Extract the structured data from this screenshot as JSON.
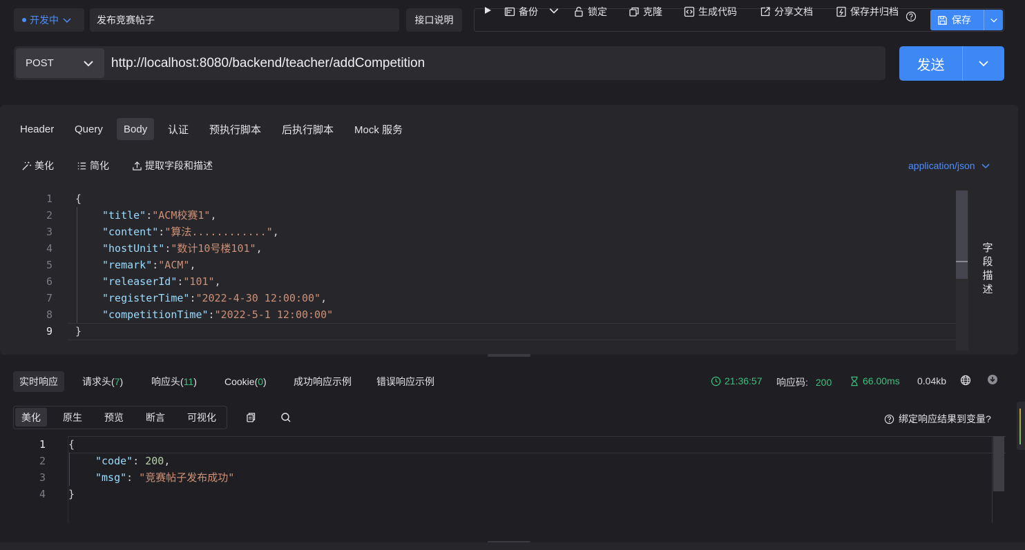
{
  "header": {
    "env_label": "开发中",
    "api_name": "发布竞赛帖子",
    "doc_button": "接口说明",
    "toolbar": {
      "run": "",
      "backup": "备份",
      "lock": "锁定",
      "clone": "克隆",
      "generate_code": "生成代码",
      "share_doc": "分享文档",
      "save_archive": "保存并归档",
      "save": "保存"
    }
  },
  "request": {
    "method": "POST",
    "url": "http://localhost:8080/backend/teacher/addCompetition",
    "send_label": "发送",
    "tabs": [
      "Header",
      "Query",
      "Body",
      "认证",
      "预执行脚本",
      "后执行脚本",
      "Mock 服务"
    ],
    "active_tab": "Body",
    "body_tools": [
      "美化",
      "简化",
      "提取字段和描述"
    ],
    "content_type": "application/json",
    "field_desc_label": "字段描述",
    "body_lines": [
      {
        "n": "1",
        "text": "{"
      },
      {
        "n": "2",
        "key": "\"title\"",
        "val": "\"ACM校赛1\"",
        "end": ","
      },
      {
        "n": "3",
        "key": "\"content\"",
        "val": "\"算法............\"",
        "end": ","
      },
      {
        "n": "4",
        "key": "\"hostUnit\"",
        "val": "\"数计10号楼101\"",
        "end": ","
      },
      {
        "n": "5",
        "key": "\"remark\"",
        "val": "\"ACM\"",
        "end": ","
      },
      {
        "n": "6",
        "key": "\"releaserId\"",
        "val": "\"101\"",
        "end": ","
      },
      {
        "n": "7",
        "key": "\"registerTime\"",
        "val": "\"2022-4-30 12:00:00\"",
        "end": ","
      },
      {
        "n": "8",
        "key": "\"competitionTime\"",
        "val": "\"2022-5-1 12:00:00\"",
        "end": ""
      },
      {
        "n": "9",
        "text": "}"
      }
    ]
  },
  "response": {
    "tabs": [
      {
        "label": "实时响应"
      },
      {
        "label": "请求头(",
        "count": "7",
        "close": ")"
      },
      {
        "label": "响应头(",
        "count": "11",
        "close": ")"
      },
      {
        "label": "Cookie(",
        "count": "0",
        "close": ")"
      },
      {
        "label": "成功响应示例"
      },
      {
        "label": "错误响应示例"
      }
    ],
    "time": "21:36:57",
    "status_label": "响应码:",
    "status_code": "200",
    "duration": "66.00ms",
    "size": "0.04kb",
    "view_tabs": [
      "美化",
      "原生",
      "预览",
      "断言",
      "可视化"
    ],
    "bind_var_label": "绑定响应结果到变量?",
    "body_lines": [
      {
        "n": "1",
        "text": "{"
      },
      {
        "n": "2",
        "key": "\"code\"",
        "val": "200",
        "end": ","
      },
      {
        "n": "3",
        "key": "\"msg\"",
        "val": "\"竞赛帖子发布成功\"",
        "end": ""
      },
      {
        "n": "4",
        "text": "}"
      }
    ]
  },
  "colors": {
    "accent": "#3e88f5",
    "success": "#3fbf7f",
    "json_key": "#9cdcfe",
    "json_string": "#ce9178",
    "json_number": "#b5cea8"
  }
}
